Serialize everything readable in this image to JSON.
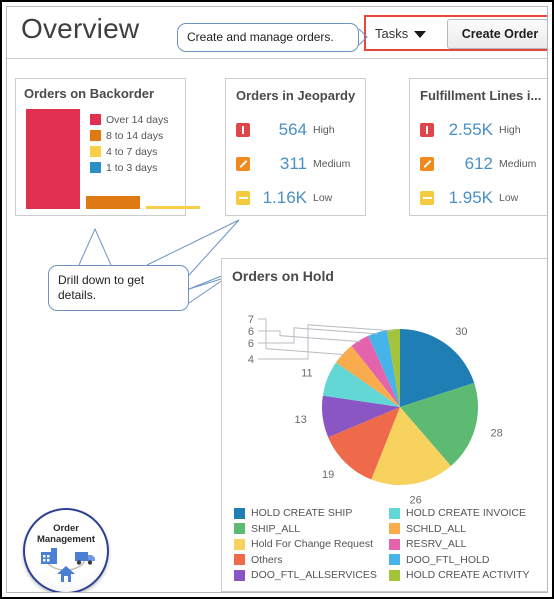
{
  "header": {
    "title": "Overview",
    "tasks_label": "Tasks",
    "create_order_label": "Create Order",
    "caret_icon": "chevron-down-icon",
    "highlight_color": "#e8473f"
  },
  "callouts": {
    "top": "Create and manage orders.",
    "drill": "Drill down to get details."
  },
  "backorder": {
    "title": "Orders on Backorder",
    "chart_data": {
      "type": "bar",
      "title": "Orders on Backorder",
      "categories": [
        "Over 14 days",
        "8 to 14 days",
        "4 to 7 days",
        "1 to 3 days"
      ],
      "values": [
        100,
        13,
        2,
        0
      ],
      "colors": [
        "#e03050",
        "#df7914",
        "#f9cf4a",
        "#2a8fc4"
      ],
      "xlabel": "",
      "ylabel": "",
      "ylim": [
        0,
        100
      ],
      "grid": false,
      "legend_position": "inside-right"
    }
  },
  "jeopardy": {
    "title": "Orders in Jeopardy",
    "rows": [
      {
        "icon": "severity-high-icon",
        "value": "564",
        "label": "High",
        "color": "#e0454a"
      },
      {
        "icon": "severity-medium-icon",
        "value": "311",
        "label": "Medium",
        "color": "#f08a1e"
      },
      {
        "icon": "severity-low-icon",
        "value": "1.16K",
        "label": "Low",
        "color": "#f6cb3f"
      }
    ]
  },
  "fulfillment": {
    "title": "Fulfillment Lines i...",
    "rows": [
      {
        "icon": "severity-high-icon",
        "value": "2.55K",
        "label": "High",
        "color": "#e0454a"
      },
      {
        "icon": "severity-medium-icon",
        "value": "612",
        "label": "Medium",
        "color": "#f08a1e"
      },
      {
        "icon": "severity-low-icon",
        "value": "1.95K",
        "label": "Low",
        "color": "#f6cb3f"
      }
    ]
  },
  "hold": {
    "title": "Orders on Hold",
    "chart_data": {
      "type": "pie",
      "title": "Orders on Hold",
      "categories": [
        "HOLD CREATE SHIP",
        "SHIP_ALL",
        "Hold For Change Request",
        "Others",
        "DOO_FTL_ALLSERVICES",
        "HOLD CREATE INVOICE",
        "SCHLD_ALL",
        "RESRV_ALL",
        "DOO_FTL_HOLD",
        "HOLD CREATE ACTIVITY"
      ],
      "values": [
        30,
        28,
        26,
        19,
        13,
        11,
        7,
        6,
        6,
        4
      ],
      "colors": [
        "#1f7fb5",
        "#5cba73",
        "#f7d25e",
        "#ee6a4a",
        "#8a56c4",
        "#63d6d6",
        "#f9ab4e",
        "#e363ad",
        "#46b4e8",
        "#a3c43a"
      ],
      "labels_shown": [
        "30",
        "28",
        "26",
        "19",
        "13",
        "11",
        "7",
        "6",
        "6",
        "4"
      ],
      "legend_position": "bottom",
      "legend_columns": 2
    }
  },
  "badge": {
    "line1": "Order",
    "line2": "Management",
    "icons": [
      "factory-icon",
      "truck-icon",
      "house-icon"
    ]
  }
}
